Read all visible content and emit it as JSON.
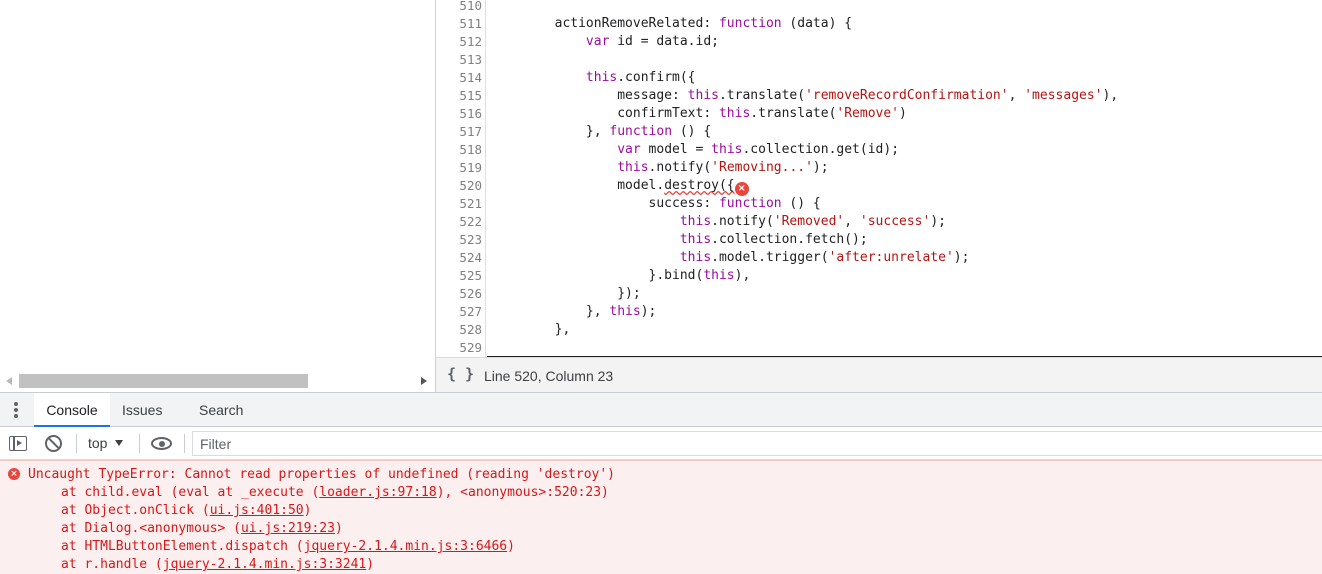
{
  "editor": {
    "lines": [
      {
        "num": "510",
        "code": ""
      },
      {
        "num": "511",
        "code": "        actionRemoveRelated: function (data) {"
      },
      {
        "num": "512",
        "code": "            var id = data.id;"
      },
      {
        "num": "513",
        "code": ""
      },
      {
        "num": "514",
        "code": "            this.confirm({"
      },
      {
        "num": "515",
        "code": "                message: this.translate('removeRecordConfirmation', 'messages'),"
      },
      {
        "num": "516",
        "code": "                confirmText: this.translate('Remove')"
      },
      {
        "num": "517",
        "code": "            }, function () {"
      },
      {
        "num": "518",
        "code": "                var model = this.collection.get(id);"
      },
      {
        "num": "519",
        "code": "                this.notify('Removing...');"
      },
      {
        "num": "520",
        "code": "                model.destroy({"
      },
      {
        "num": "521",
        "code": "                    success: function () {"
      },
      {
        "num": "522",
        "code": "                        this.notify('Removed', 'success');"
      },
      {
        "num": "523",
        "code": "                        this.collection.fetch();"
      },
      {
        "num": "524",
        "code": "                        this.model.trigger('after:unrelate');"
      },
      {
        "num": "525",
        "code": "                    }.bind(this),"
      },
      {
        "num": "526",
        "code": "                });"
      },
      {
        "num": "527",
        "code": "            }, this);"
      },
      {
        "num": "528",
        "code": "        },"
      },
      {
        "num": "529",
        "code": ""
      }
    ],
    "error_line": "520",
    "error_marker": "×"
  },
  "status_bar": {
    "braces_icon": "{ }",
    "position": "Line 520, Column 23"
  },
  "drawer": {
    "tabs": [
      "Console",
      "Issues",
      "Search"
    ],
    "active_tab": "Console"
  },
  "console_toolbar": {
    "context": "top",
    "filter_placeholder": "Filter",
    "filter_value": ""
  },
  "console_message": {
    "level": "error",
    "icon": "×",
    "headline": "Uncaught TypeError: Cannot read properties of undefined (reading 'destroy')",
    "stack": [
      {
        "prefix": "at child.eval (eval at _execute (",
        "link": "loader.js:97:18",
        "suffix": "), <anonymous>:520:23)"
      },
      {
        "prefix": "at Object.onClick (",
        "link": "ui.js:401:50",
        "suffix": ")"
      },
      {
        "prefix": "at Dialog.<anonymous> (",
        "link": "ui.js:219:23",
        "suffix": ")"
      },
      {
        "prefix": "at HTMLButtonElement.dispatch (",
        "link": "jquery-2.1.4.min.js:3:6466",
        "suffix": ")"
      },
      {
        "prefix": "at r.handle (",
        "link": "jquery-2.1.4.min.js:3:3241",
        "suffix": ")"
      }
    ]
  },
  "colors": {
    "keyword": "#9a0d9c",
    "string": "#b31412",
    "error": "#d61818",
    "accent": "#1a73e8"
  }
}
